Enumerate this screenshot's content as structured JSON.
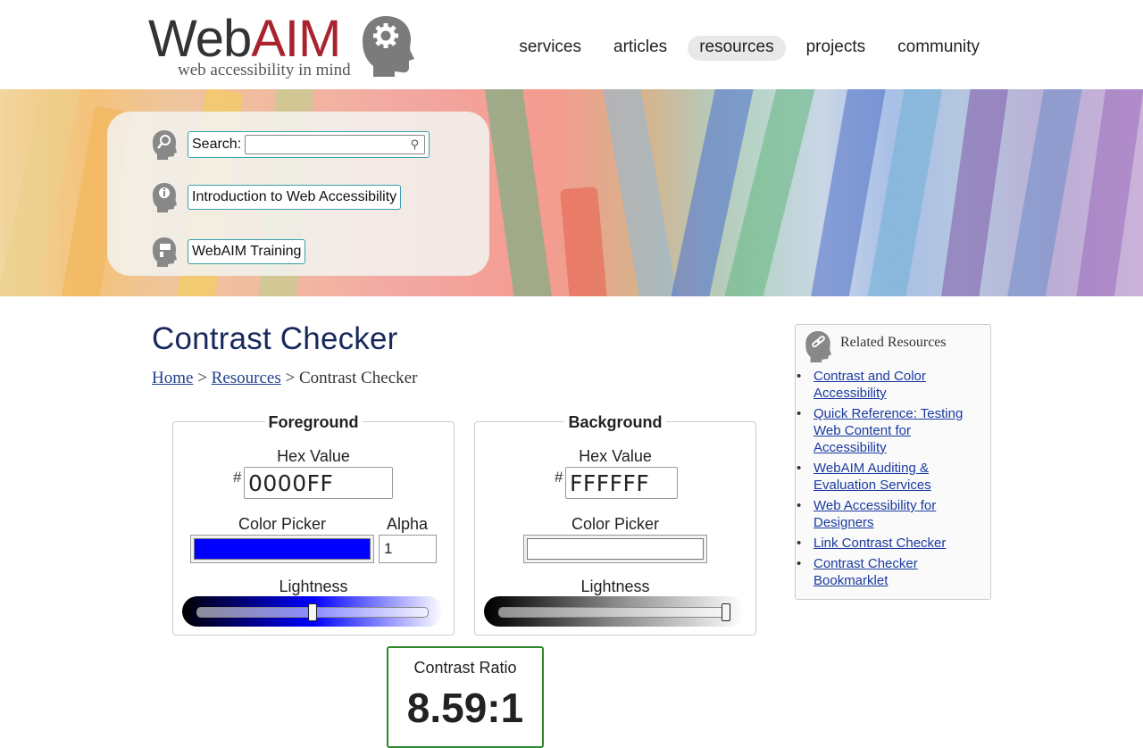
{
  "logo": {
    "wordmark_web": "Web",
    "wordmark_aim": "AIM",
    "tagline": "web accessibility in mind",
    "brand_red": "#a8232d"
  },
  "nav": {
    "items": [
      {
        "label": "services",
        "active": false
      },
      {
        "label": "articles",
        "active": false
      },
      {
        "label": "resources",
        "active": true
      },
      {
        "label": "projects",
        "active": false
      },
      {
        "label": "community",
        "active": false
      }
    ]
  },
  "quicklinks": {
    "search_label": "Search:",
    "search_value": "",
    "intro_label": "Introduction to Web Accessibility",
    "training_label": "WebAIM Training"
  },
  "page": {
    "title": "Contrast Checker",
    "breadcrumb": {
      "home": "Home",
      "sep1": ">",
      "resources": "Resources",
      "sep2": ">",
      "current": "Contrast Checker"
    }
  },
  "foreground": {
    "legend": "Foreground",
    "hex_label": "Hex Value",
    "hash": "#",
    "hex_value": "0000FF",
    "picker_label": "Color Picker",
    "picker_color": "#0000ff",
    "alpha_label": "Alpha",
    "alpha_value": "1",
    "lightness_label": "Lightness",
    "lightness_value": 0.5
  },
  "background": {
    "legend": "Background",
    "hex_label": "Hex Value",
    "hash": "#",
    "hex_value": "FFFFFF",
    "picker_label": "Color Picker",
    "picker_color": "#ffffff",
    "lightness_label": "Lightness",
    "lightness_value": 1.0
  },
  "result": {
    "label": "Contrast Ratio",
    "value": "8.59:1",
    "pass_color": "#2c8a2c"
  },
  "sidebar": {
    "title": "Related Resources",
    "links": [
      "Contrast and Color Accessibility",
      "Quick Reference: Testing Web Content for Accessibility",
      "WebAIM Auditing & Evaluation Services",
      "Web Accessibility for Designers",
      "Link Contrast Checker",
      "Contrast Checker Bookmarklet"
    ]
  }
}
